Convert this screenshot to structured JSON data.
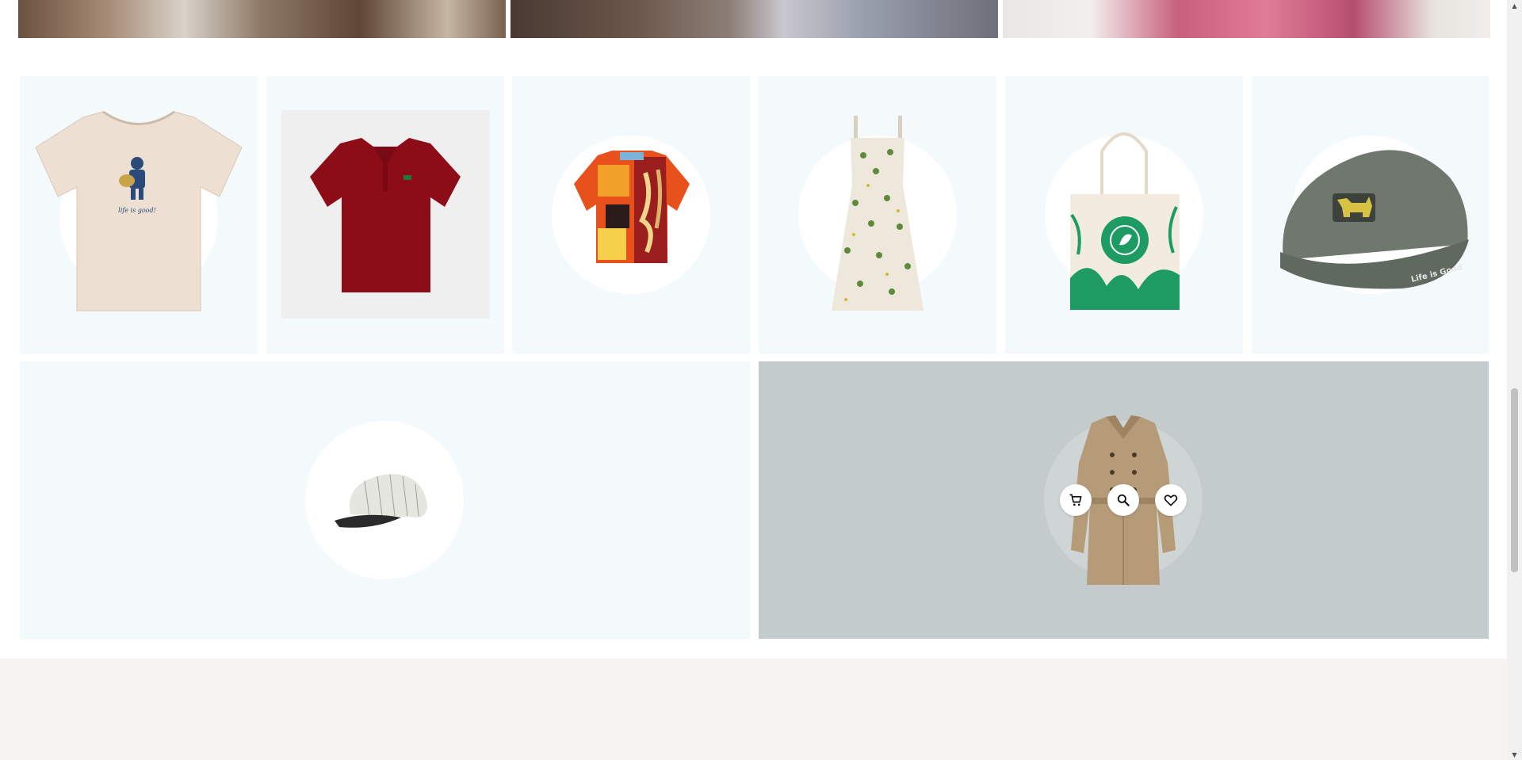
{
  "banners": [
    {
      "name": "banner-image-denim"
    },
    {
      "name": "banner-image-model"
    },
    {
      "name": "banner-image-pink-top"
    }
  ],
  "products": [
    {
      "name": "product-tshirt",
      "image": "cream t-shirt",
      "print_text": "life is good!"
    },
    {
      "name": "product-polo",
      "image": "red polo shirt"
    },
    {
      "name": "product-hawaiian-shirt",
      "image": "patterned shirt"
    },
    {
      "name": "product-floral-dress",
      "image": "floral sundress"
    },
    {
      "name": "product-tote-bag",
      "image": "canvas tote bag"
    },
    {
      "name": "product-dad-cap",
      "image": "grey cap",
      "print_text": "Life is Good"
    }
  ],
  "featured": [
    {
      "name": "product-baseball-cap",
      "image": "white striped cap"
    },
    {
      "name": "product-trench-coat",
      "image": "beige trench coat"
    }
  ],
  "actions": {
    "add_to_cart": "cart-icon",
    "quick_view": "search-icon",
    "wishlist": "heart-icon"
  },
  "colors": {
    "card_bg": "#f4f9fc",
    "featured_bg": "#c4cbcc",
    "footer_bg": "#f8f3f3"
  }
}
